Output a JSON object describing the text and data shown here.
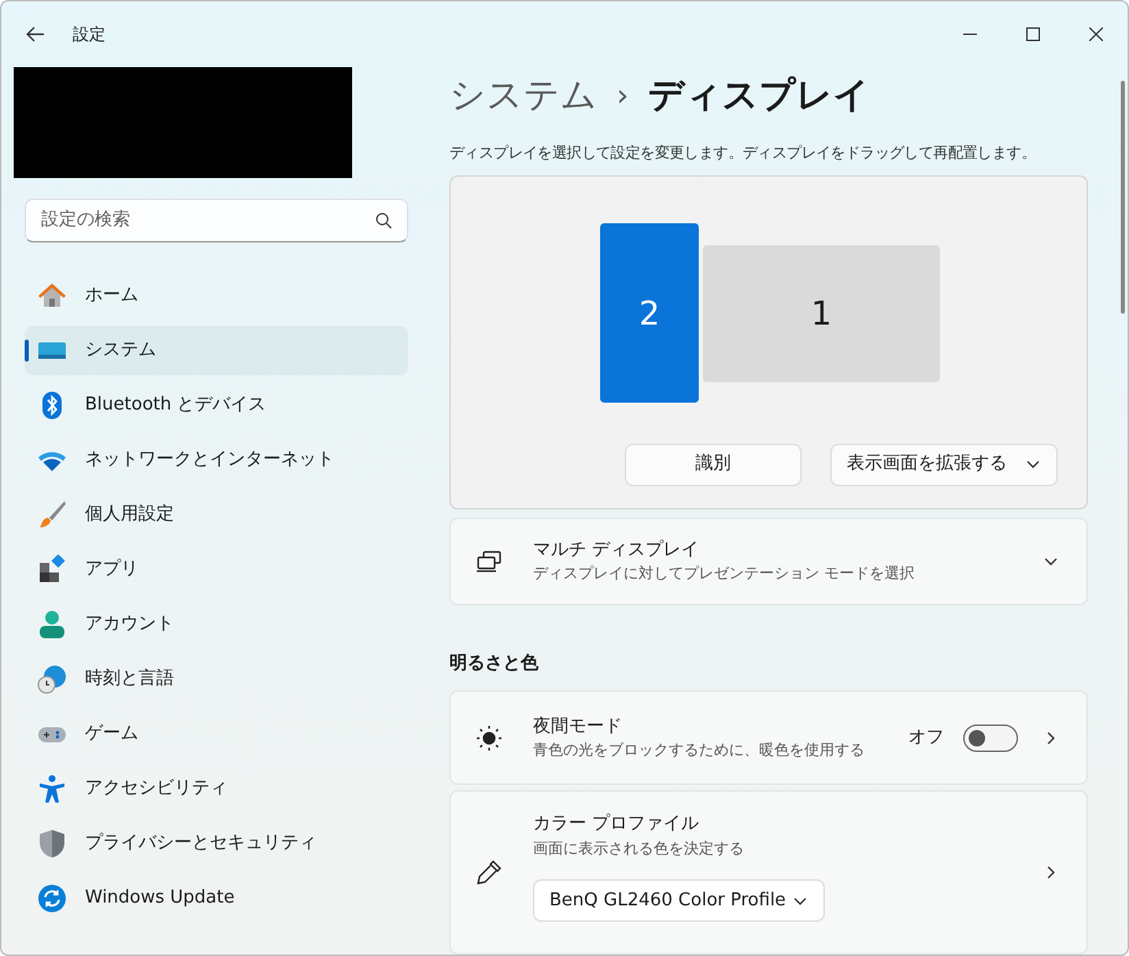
{
  "window": {
    "title": "設定"
  },
  "search": {
    "placeholder": "設定の検索"
  },
  "sidebar": {
    "items": [
      {
        "label": "ホーム",
        "selected": false
      },
      {
        "label": "システム",
        "selected": true
      },
      {
        "label": "Bluetooth とデバイス",
        "selected": false
      },
      {
        "label": "ネットワークとインターネット",
        "selected": false
      },
      {
        "label": "個人用設定",
        "selected": false
      },
      {
        "label": "アプリ",
        "selected": false
      },
      {
        "label": "アカウント",
        "selected": false
      },
      {
        "label": "時刻と言語",
        "selected": false
      },
      {
        "label": "ゲーム",
        "selected": false
      },
      {
        "label": "アクセシビリティ",
        "selected": false
      },
      {
        "label": "プライバシーとセキュリティ",
        "selected": false
      },
      {
        "label": "Windows Update",
        "selected": false
      }
    ]
  },
  "breadcrumb": {
    "parent": "システム",
    "separator": "›",
    "current": "ディスプレイ"
  },
  "arrangement": {
    "description": "ディスプレイを選択して設定を変更します。ディスプレイをドラッグして再配置します。",
    "monitors": [
      {
        "label": "2",
        "selected": true
      },
      {
        "label": "1",
        "selected": false
      }
    ],
    "identify_button": "識別",
    "mode_dropdown": "表示画面を拡張する"
  },
  "multi_display": {
    "title": "マルチ ディスプレイ",
    "subtitle": "ディスプレイに対してプレゼンテーション モードを選択",
    "expanded": false
  },
  "section_title": "明るさと色",
  "night_light": {
    "title": "夜間モード",
    "subtitle": "青色の光をブロックするために、暖色を使用する",
    "status": "オフ",
    "on": false
  },
  "color_profile": {
    "title": "カラー プロファイル",
    "subtitle": "画面に表示される色を決定する",
    "dropdown": "BenQ GL2460 Color Profile"
  }
}
